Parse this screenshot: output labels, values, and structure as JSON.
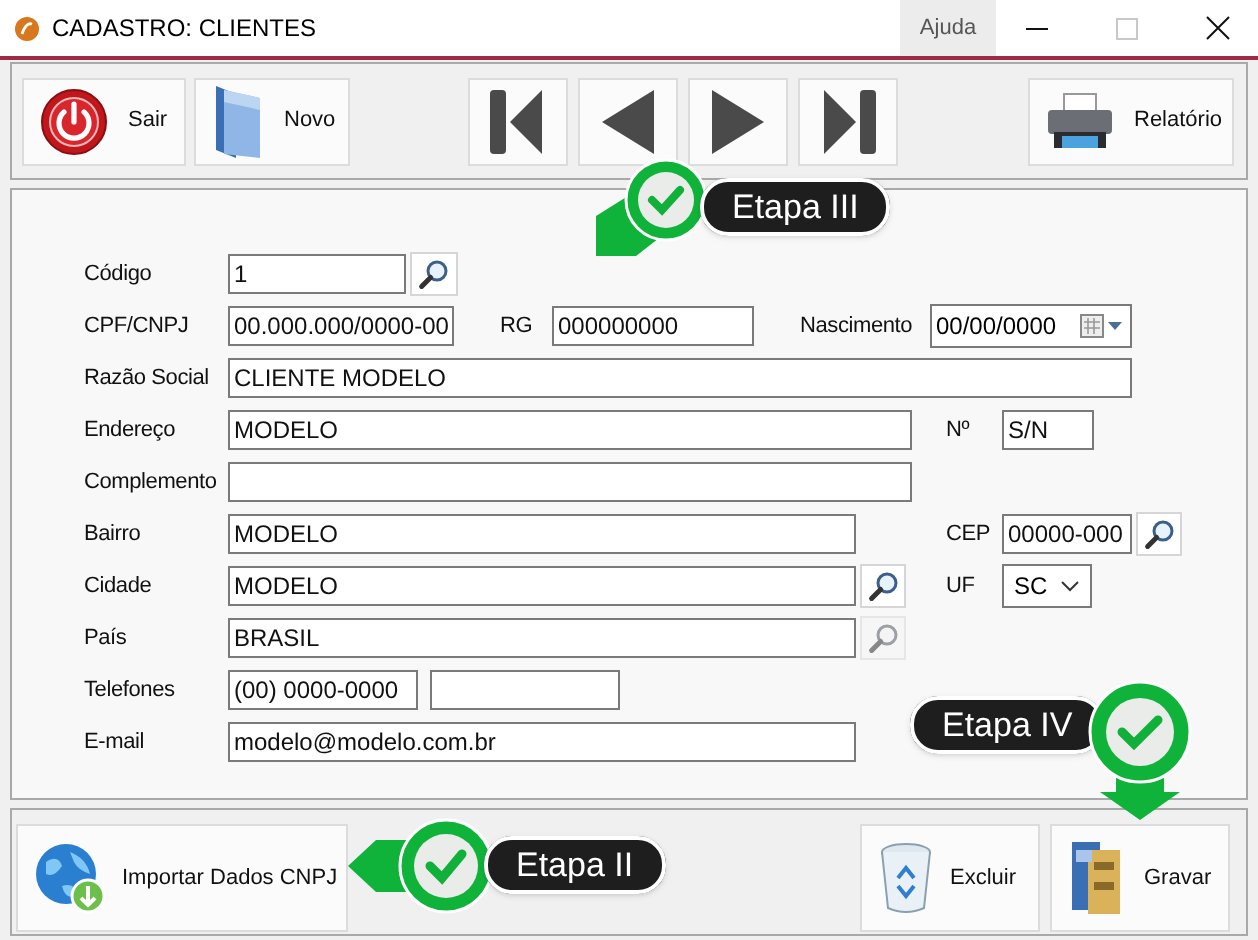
{
  "window": {
    "title": "CADASTRO: CLIENTES",
    "help_tab": "Ajuda"
  },
  "toolbar": [
    {
      "kind": "power",
      "label": "Sair"
    },
    {
      "kind": "folder",
      "label": "Novo"
    },
    {
      "kind": "first"
    },
    {
      "kind": "prev"
    },
    {
      "kind": "next"
    },
    {
      "kind": "last"
    },
    {
      "kind": "printer",
      "label": "Relatório"
    }
  ],
  "form_rows": [
    [
      {
        "kind": "label",
        "text": "Código"
      },
      {
        "kind": "input",
        "value": "1"
      },
      {
        "kind": "search",
        "disabled": false
      }
    ],
    [
      {
        "kind": "label",
        "text": "CPF/CNPJ"
      },
      {
        "kind": "input",
        "value": "00.000.000/0000-00"
      },
      {
        "kind": "label",
        "text": "RG"
      },
      {
        "kind": "input",
        "value": "000000000"
      },
      {
        "kind": "label",
        "text": "Nascimento"
      },
      {
        "kind": "date",
        "value": "00/00/0000"
      }
    ],
    [
      {
        "kind": "label",
        "text": "Razão Social"
      },
      {
        "kind": "input",
        "value": "CLIENTE MODELO"
      }
    ],
    [
      {
        "kind": "label",
        "text": "Endereço"
      },
      {
        "kind": "input",
        "value": "MODELO"
      },
      {
        "kind": "label",
        "text": "Nº"
      },
      {
        "kind": "input",
        "value": "S/N"
      }
    ],
    [
      {
        "kind": "label",
        "text": "Complemento"
      },
      {
        "kind": "input"
      }
    ],
    [
      {
        "kind": "label",
        "text": "Bairro"
      },
      {
        "kind": "input",
        "value": "MODELO"
      },
      {
        "kind": "label",
        "text": "CEP"
      },
      {
        "kind": "input",
        "value": "00000-000"
      },
      {
        "kind": "search",
        "disabled": false
      }
    ],
    [
      {
        "kind": "label",
        "text": "Cidade"
      },
      {
        "kind": "input",
        "value": "MODELO"
      },
      {
        "kind": "search",
        "disabled": false
      },
      {
        "kind": "label",
        "text": "UF"
      },
      {
        "kind": "select",
        "value": "SC"
      }
    ],
    [
      {
        "kind": "label",
        "text": "País"
      },
      {
        "kind": "input",
        "value": "BRASIL"
      },
      {
        "kind": "search",
        "disabled": true
      }
    ],
    [
      {
        "kind": "label",
        "text": "Telefones"
      },
      {
        "kind": "input",
        "value": "(00) 0000-0000"
      },
      {
        "kind": "input"
      }
    ],
    [
      {
        "kind": "label",
        "text": "E-mail"
      },
      {
        "kind": "input",
        "value": "modelo@modelo.com.br"
      }
    ]
  ],
  "bottom_buttons": [
    {
      "kind": "globe",
      "label": "Importar Dados CNPJ"
    },
    {
      "kind": "trash",
      "label": "Excluir"
    },
    {
      "kind": "binder",
      "label": "Gravar"
    }
  ],
  "callouts": [
    {
      "kind": "pin-left",
      "text": "Etapa III"
    },
    {
      "kind": "arrow-left",
      "text": "Etapa II"
    },
    {
      "kind": "pin-down",
      "text": "Etapa IV"
    }
  ]
}
